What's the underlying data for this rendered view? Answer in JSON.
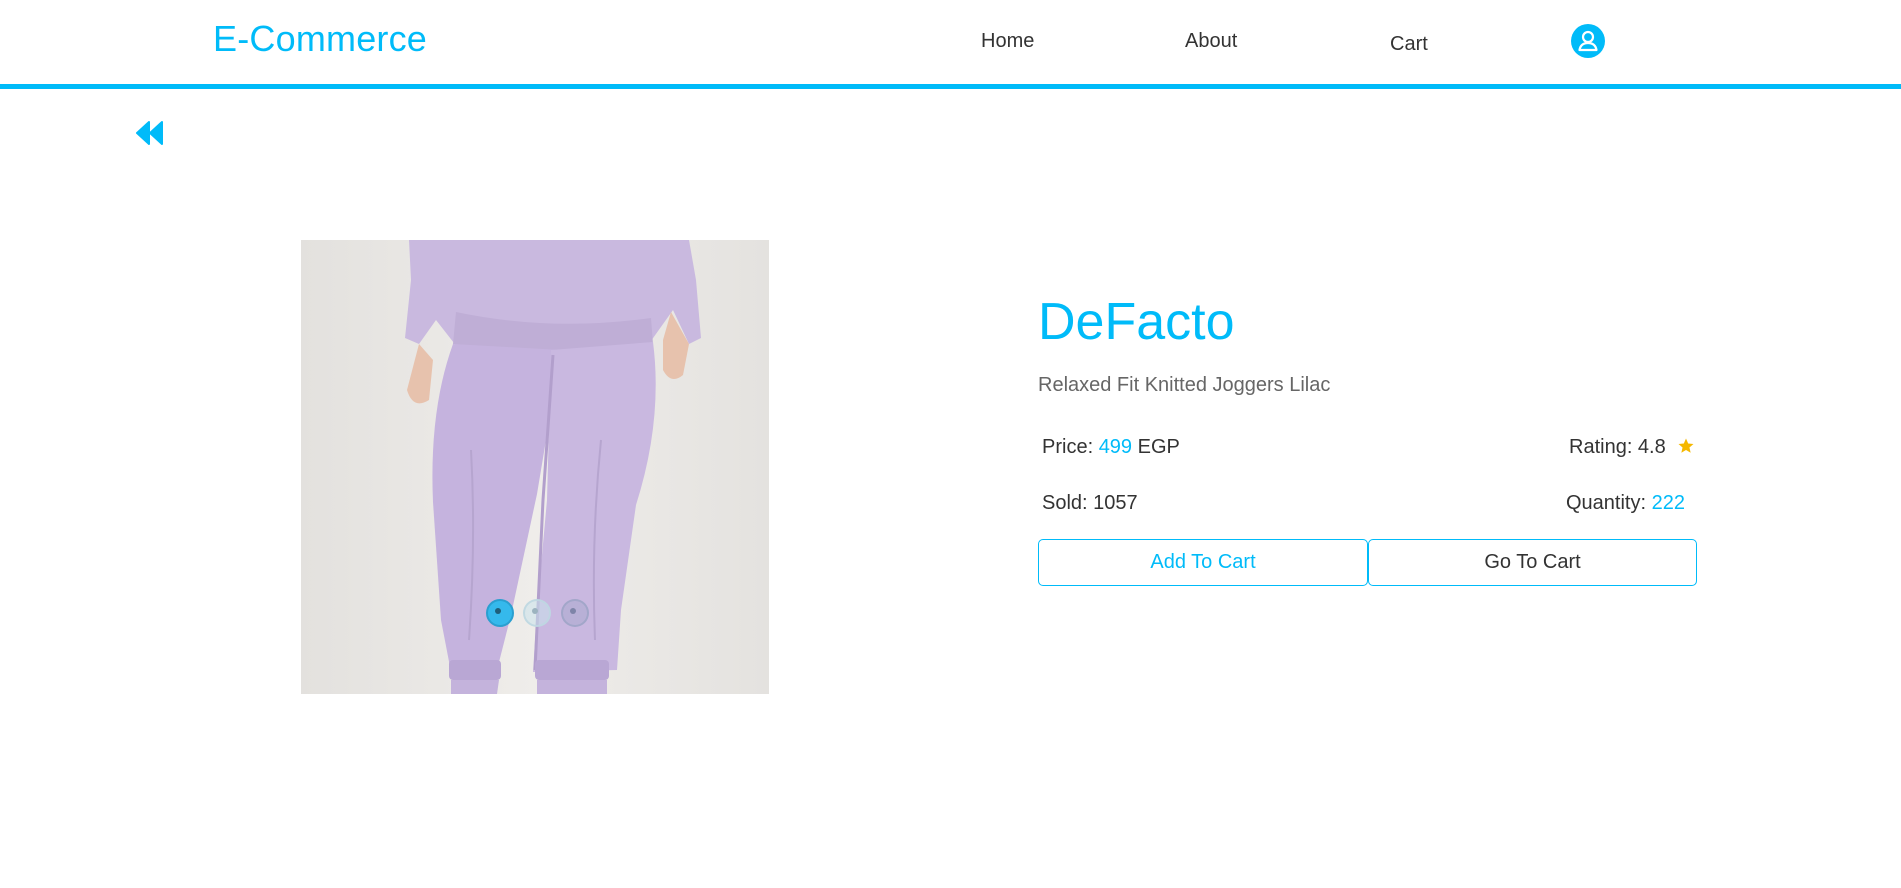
{
  "navbar": {
    "brand": "E-Commerce",
    "links": [
      "Home",
      "About",
      "Cart"
    ],
    "user_icon": "user-circle-icon",
    "accent": "#00bbf9"
  },
  "back_icon": "double-chevron-left-icon",
  "product": {
    "brand": "DeFacto",
    "title": "Relaxed Fit Knitted Joggers Lilac",
    "price_label": "Price:",
    "price_value": "499",
    "currency": "EGP",
    "rating_label": "Rating: 4.8",
    "rating_value": 4.8,
    "rating_icon": "star-icon",
    "sold_label": "Sold: 1057",
    "quantity_label": "Quantity:",
    "quantity_value": "222",
    "carousel": {
      "slides": 3,
      "active": 1
    }
  },
  "buttons": {
    "add_to_cart": "Add To Cart",
    "go_to_cart": "Go To Cart"
  },
  "colors": {
    "accent": "#00bbf9",
    "star": "#f5b800",
    "product_bg": "#ebe9e6",
    "lilac": "#c8b8dd"
  }
}
